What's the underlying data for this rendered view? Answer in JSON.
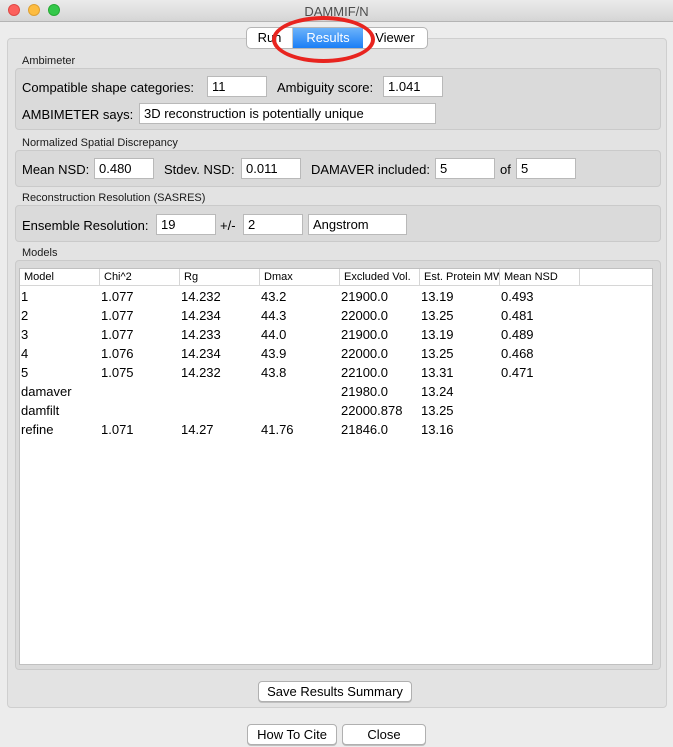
{
  "window": {
    "title": "DAMMIF/N"
  },
  "tabs": [
    {
      "label": "Run"
    },
    {
      "label": "Results"
    },
    {
      "label": "Viewer"
    }
  ],
  "ambimeter": {
    "section_title": "Ambimeter",
    "shape_categories_label": "Compatible shape categories:",
    "shape_categories_value": "11",
    "ambiguity_label": "Ambiguity score:",
    "ambiguity_value": "1.041",
    "says_label": "AMBIMETER says:",
    "says_value": "3D reconstruction is potentially unique"
  },
  "nsd": {
    "section_title": "Normalized Spatial Discrepancy",
    "mean_label": "Mean NSD:",
    "mean_value": "0.480",
    "stdev_label": "Stdev. NSD:",
    "stdev_value": "0.011",
    "damaver_label": "DAMAVER included:",
    "damaver_value": "5",
    "of_label": "of",
    "of_value": "5"
  },
  "sasres": {
    "section_title": "Reconstruction Resolution (SASRES)",
    "ensemble_label": "Ensemble Resolution:",
    "ensemble_value": "19",
    "pm_label": "+/-",
    "pm_value": "2",
    "unit_value": "Angstrom"
  },
  "models": {
    "section_title": "Models",
    "columns": [
      "Model",
      "Chi^2",
      "Rg",
      "Dmax",
      "Excluded Vol.",
      "Est. Protein MW",
      "Mean NSD"
    ],
    "rows": [
      [
        "1",
        "1.077",
        "14.232",
        "43.2",
        "21900.0",
        "13.19",
        "0.493"
      ],
      [
        "2",
        "1.077",
        "14.234",
        "44.3",
        "22000.0",
        "13.25",
        "0.481"
      ],
      [
        "3",
        "1.077",
        "14.233",
        "44.0",
        "21900.0",
        "13.19",
        "0.489"
      ],
      [
        "4",
        "1.076",
        "14.234",
        "43.9",
        "22000.0",
        "13.25",
        "0.468"
      ],
      [
        "5",
        "1.075",
        "14.232",
        "43.8",
        "22100.0",
        "13.31",
        "0.471"
      ],
      [
        "damaver",
        "",
        "",
        "",
        "21980.0",
        "13.24",
        ""
      ],
      [
        "damfilt",
        "",
        "",
        "",
        "22000.878",
        "13.25",
        ""
      ],
      [
        "refine",
        "1.071",
        "14.27",
        "41.76",
        "21846.0",
        "13.16",
        ""
      ]
    ]
  },
  "buttons": {
    "save_summary": "Save Results Summary",
    "how_to_cite": "How To Cite",
    "close": "Close"
  },
  "colors": {
    "selected_tab": "#1b7ef6",
    "annotation_circle": "#e8241f"
  }
}
